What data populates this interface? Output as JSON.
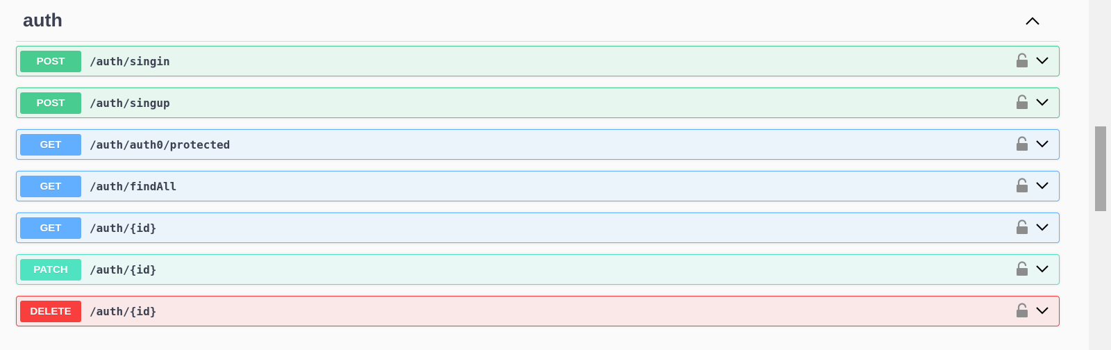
{
  "section": {
    "title": "auth",
    "collapse_icon": "chevron-up-icon"
  },
  "operations": [
    {
      "method": "POST",
      "path": "/auth/singin",
      "kind": "post"
    },
    {
      "method": "POST",
      "path": "/auth/singup",
      "kind": "post"
    },
    {
      "method": "GET",
      "path": "/auth/auth0/protected",
      "kind": "get"
    },
    {
      "method": "GET",
      "path": "/auth/findAll",
      "kind": "get"
    },
    {
      "method": "GET",
      "path": "/auth/{id}",
      "kind": "get"
    },
    {
      "method": "PATCH",
      "path": "/auth/{id}",
      "kind": "patch"
    },
    {
      "method": "DELETE",
      "path": "/auth/{id}",
      "kind": "delete"
    }
  ],
  "icons": {
    "lock": "unlocked-padlock-icon",
    "expand": "chevron-down-icon"
  },
  "colors": {
    "post": "#49cc90",
    "get": "#61affe",
    "patch": "#50e3c2",
    "delete": "#f93e3e",
    "title": "#3b4151"
  }
}
